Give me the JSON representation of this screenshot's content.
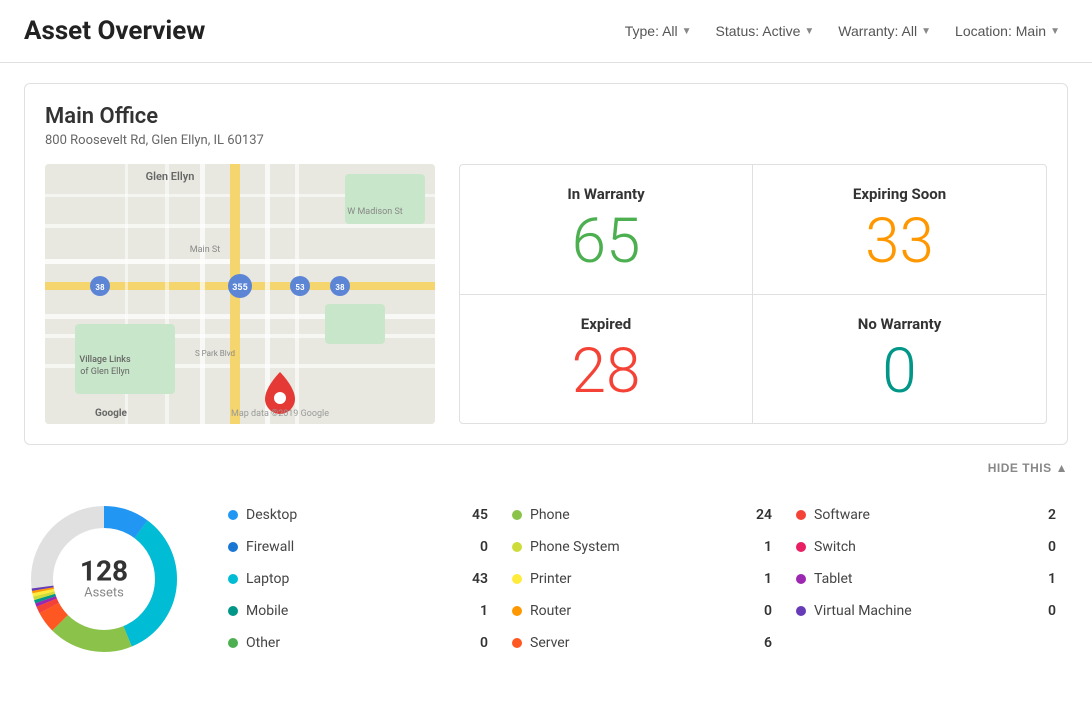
{
  "header": {
    "title": "Asset Overview",
    "filters": [
      {
        "label": "Type: All",
        "id": "type-filter"
      },
      {
        "label": "Status: Active",
        "id": "status-filter"
      },
      {
        "label": "Warranty: All",
        "id": "warranty-filter"
      },
      {
        "label": "Location: Main",
        "id": "location-filter"
      }
    ]
  },
  "location": {
    "name": "Main Office",
    "address": "800 Roosevelt Rd, Glen Ellyn, IL 60137"
  },
  "warranty": {
    "in_warranty_label": "In Warranty",
    "in_warranty_value": "65",
    "expiring_soon_label": "Expiring Soon",
    "expiring_soon_value": "33",
    "expired_label": "Expired",
    "expired_value": "28",
    "no_warranty_label": "No Warranty",
    "no_warranty_value": "0"
  },
  "hide_button": "HIDE THIS",
  "assets": {
    "total": "128",
    "total_label": "Assets",
    "items": [
      {
        "name": "Desktop",
        "count": "45",
        "color": "#2196f3"
      },
      {
        "name": "Firewall",
        "count": "0",
        "color": "#1976d2"
      },
      {
        "name": "Laptop",
        "count": "43",
        "color": "#00bcd4"
      },
      {
        "name": "Mobile",
        "count": "1",
        "color": "#009688"
      },
      {
        "name": "Other",
        "count": "0",
        "color": "#4caf50"
      },
      {
        "name": "Phone",
        "count": "24",
        "color": "#8bc34a"
      },
      {
        "name": "Phone System",
        "count": "1",
        "color": "#cddc39"
      },
      {
        "name": "Printer",
        "count": "1",
        "color": "#ffeb3b"
      },
      {
        "name": "Router",
        "count": "0",
        "color": "#ff9800"
      },
      {
        "name": "Server",
        "count": "6",
        "color": "#ff5722"
      },
      {
        "name": "Software",
        "count": "2",
        "color": "#f44336"
      },
      {
        "name": "Switch",
        "count": "0",
        "color": "#e91e63"
      },
      {
        "name": "Tablet",
        "count": "1",
        "color": "#9c27b0"
      },
      {
        "name": "Virtual Machine",
        "count": "0",
        "color": "#673ab7"
      }
    ]
  }
}
